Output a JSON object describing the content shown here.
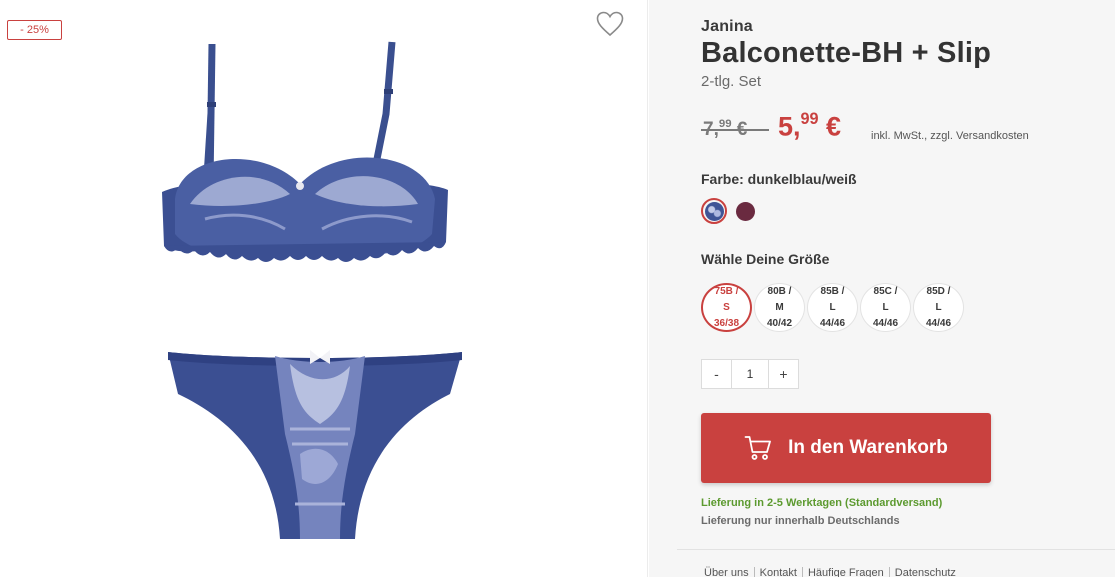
{
  "badge": {
    "discount": "- 25%"
  },
  "icons": {
    "wishlist": "heart-outline-icon",
    "cart": "shopping-cart-icon"
  },
  "product": {
    "brand": "Janina",
    "title": "Balconette-BH + Slip",
    "subtitle": "2-tlg. Set",
    "old_price_main": "7,",
    "old_price_cents": "99",
    "old_price_currency": " €",
    "new_price_main": "5,",
    "new_price_cents": "99",
    "new_price_currency": " €",
    "tax_note": "inkl. MwSt., zzgl. Versandkosten"
  },
  "color": {
    "label": "Farbe: dunkelblau/weiß",
    "swatches": [
      {
        "name": "dunkelblau/weiß",
        "hex": "#3f5496",
        "selected": true
      },
      {
        "name": "bordeaux",
        "hex": "#6a2a40",
        "selected": false
      }
    ]
  },
  "size": {
    "label": "Wähle Deine Größe",
    "options": [
      {
        "text": "75B /\nS\n36/38",
        "selected": true
      },
      {
        "text": "80B /\nM\n40/42",
        "selected": false
      },
      {
        "text": "85B /\nL\n44/46",
        "selected": false
      },
      {
        "text": "85C /\nL\n44/46",
        "selected": false
      },
      {
        "text": "85D /\nL\n44/46",
        "selected": false
      }
    ]
  },
  "quantity": {
    "minus": "-",
    "value": "1",
    "plus": "+"
  },
  "cart_button": {
    "label": "In den Warenkorb"
  },
  "delivery": {
    "time": "Lieferung in 2-5 Werktagen (Standardversand)",
    "region": "Lieferung nur innerhalb Deutschlands"
  },
  "footer": {
    "links": [
      "Über uns",
      "Kontakt",
      "Häufige Fragen",
      "Datenschutz"
    ]
  },
  "colors": {
    "accent": "#c9413f",
    "delivery_green": "#5c9a2f",
    "product_navy": "#3f5496"
  }
}
